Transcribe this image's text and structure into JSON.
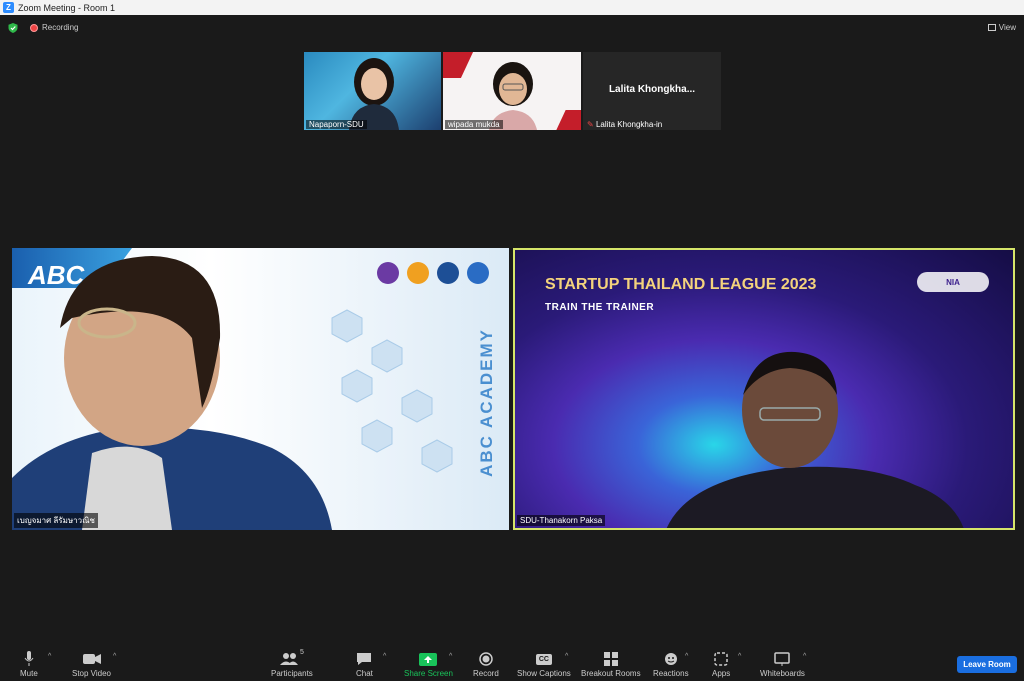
{
  "window": {
    "title": "Zoom Meeting - Room 1"
  },
  "topbar": {
    "recording_label": "Recording",
    "view_label": "View"
  },
  "thumbnails": [
    {
      "name": "Napaporn-SDU"
    },
    {
      "name": "wipada mukda"
    },
    {
      "name": "Lalita Khongkha-in",
      "display_name": "Lalita  Khongkha..."
    }
  ],
  "tiles": {
    "left": {
      "name": "เบญจมาศ ลีรัมษาวณิช",
      "backdrop_text": "ABC ACADEMY",
      "logo_text": "ABC"
    },
    "right": {
      "name": "SDU-Thanakorn Paksa",
      "backdrop_title": "STARTUP THAILAND LEAGUE 2023",
      "backdrop_subtitle": "TRAIN THE TRAINER",
      "logo_text": "NIA"
    }
  },
  "toolbar": {
    "mute": "Mute",
    "stop_video": "Stop Video",
    "participants": "Participants",
    "participants_count": "5",
    "chat": "Chat",
    "share_screen": "Share Screen",
    "record": "Record",
    "show_captions": "Show Captions",
    "breakout_rooms": "Breakout Rooms",
    "reactions": "Reactions",
    "apps": "Apps",
    "whiteboards": "Whiteboards",
    "leave_room": "Leave Room"
  },
  "colors": {
    "active_speaker": "#d6e56a",
    "share_screen": "#19c35a",
    "leave": "#1a6ee0",
    "record_dot": "#e44444"
  }
}
